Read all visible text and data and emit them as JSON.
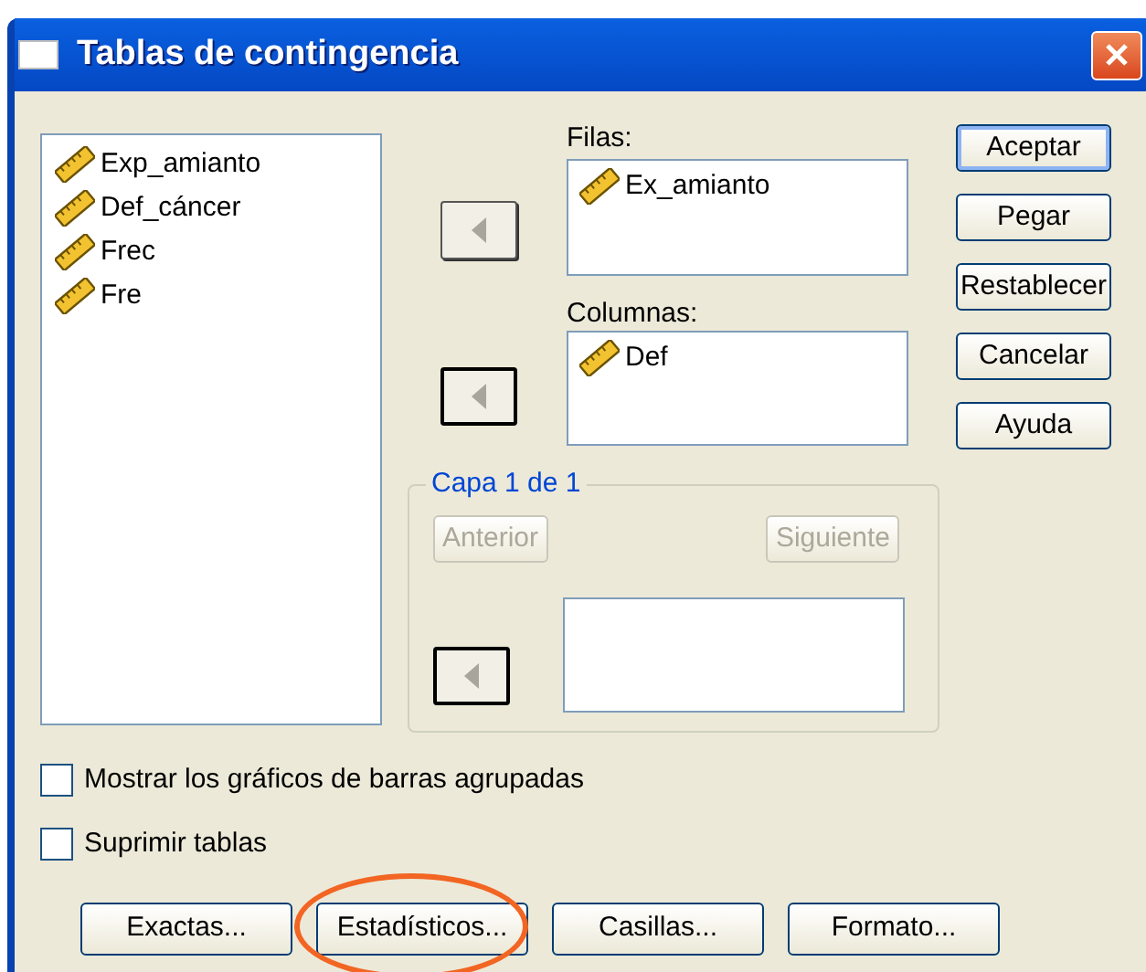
{
  "window": {
    "title": "Tablas de contingencia"
  },
  "source_variables": [
    {
      "name": "Exp_amianto"
    },
    {
      "name": "Def_cáncer"
    },
    {
      "name": "Frec"
    },
    {
      "name": "Fre"
    }
  ],
  "rows": {
    "label": "Filas:",
    "arrow_focused": false,
    "variables": [
      {
        "name": "Ex_amianto"
      }
    ]
  },
  "columns": {
    "label": "Columnas:",
    "arrow_focused": true,
    "variables": [
      {
        "name": "Def"
      }
    ]
  },
  "layer": {
    "title": "Capa 1 de 1",
    "buttons": [
      {
        "label": "Anterior",
        "disabled": true
      },
      {
        "label": "Siguiente",
        "disabled": true
      }
    ],
    "arrow_focused": true
  },
  "side_buttons": [
    {
      "label": "Aceptar",
      "default": true
    },
    {
      "label": "Pegar",
      "default": false
    },
    {
      "label": "Restablecer",
      "default": false
    },
    {
      "label": "Cancelar",
      "default": false
    },
    {
      "label": "Ayuda",
      "default": false
    }
  ],
  "options": [
    {
      "label": "Mostrar los gráficos de barras agrupadas",
      "checked": false
    },
    {
      "label": "Suprimir tablas",
      "checked": false
    }
  ],
  "bottom_buttons": [
    {
      "label": "Exactas...",
      "highlighted": false
    },
    {
      "label": "Estadísticos...",
      "highlighted": true
    },
    {
      "label": "Casillas...",
      "highlighted": false
    },
    {
      "label": "Formato...",
      "highlighted": false
    }
  ]
}
